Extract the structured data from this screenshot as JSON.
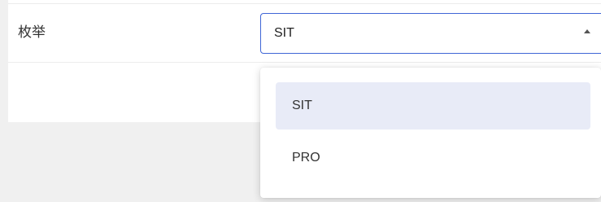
{
  "form": {
    "field_label": "枚举",
    "select": {
      "value": "SIT",
      "expanded": true,
      "options": [
        {
          "label": "SIT",
          "selected": true
        },
        {
          "label": "PRO",
          "selected": false
        }
      ]
    }
  },
  "colors": {
    "accent": "#3f66d6",
    "selected_option_bg": "#e8ebf7"
  },
  "icons": {
    "caret": "chevron-up-icon"
  }
}
